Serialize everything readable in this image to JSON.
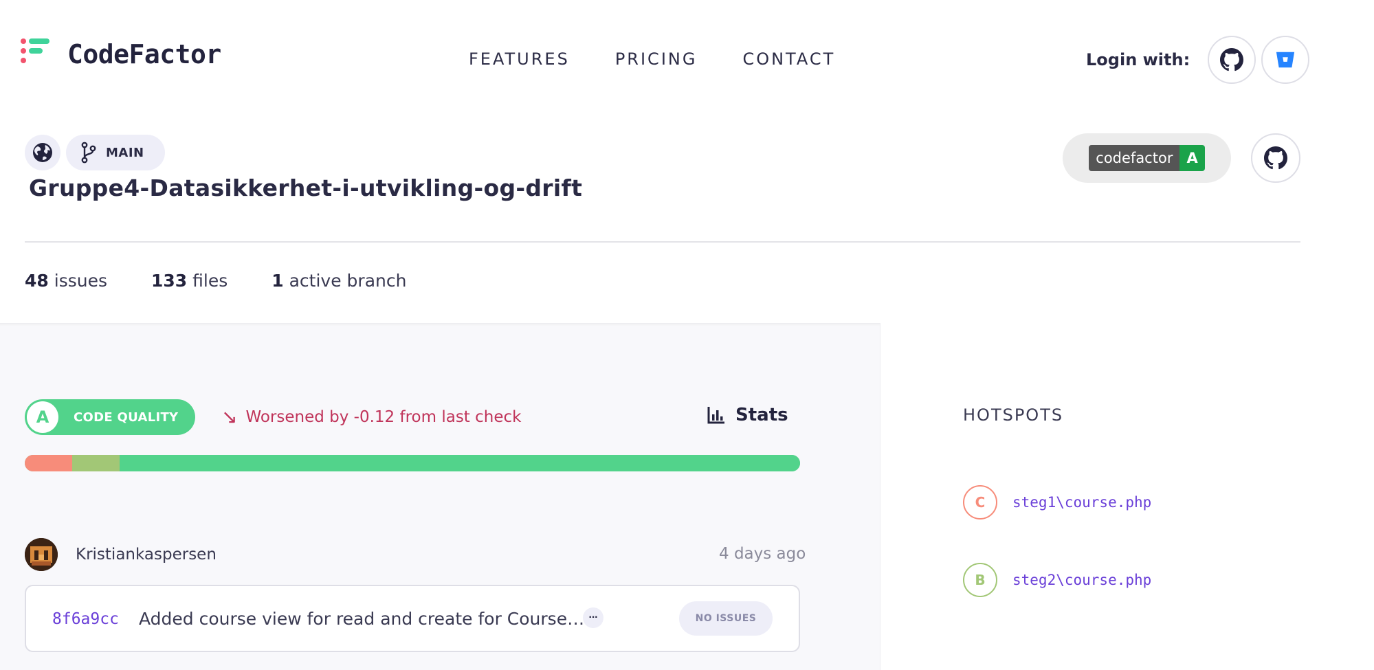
{
  "brand": {
    "name": "CodeFactor"
  },
  "nav": {
    "features": "FEATURES",
    "pricing": "PRICING",
    "contact": "CONTACT"
  },
  "login": {
    "label": "Login with:",
    "providers": [
      "github-icon",
      "bitbucket-icon"
    ]
  },
  "repo": {
    "visibility_icon": "globe-icon",
    "branch": "MAIN",
    "name": "Gruppe4-Datasikkerhet-i-utvikling-og-drift",
    "badge_left": "codefactor",
    "badge_right": "A"
  },
  "summary": {
    "issues_count": "48",
    "issues_label": "issues",
    "files_count": "133",
    "files_label": "files",
    "branches_count": "1",
    "branches_label": "active branch"
  },
  "quality": {
    "grade": "A",
    "label": "CODE QUALITY",
    "trend_arrow": "↘",
    "trend_text": "Worsened by -0.12 from last check",
    "stats_label": "Stats",
    "distribution": [
      {
        "grade": "C",
        "fraction": 0.061,
        "color": "#f78c7a"
      },
      {
        "grade": "B",
        "fraction": 0.061,
        "color": "#a2c776"
      },
      {
        "grade": "A",
        "fraction": 0.878,
        "color": "#52d38b"
      }
    ]
  },
  "commit": {
    "author": "Kristiankaspersen",
    "time": "4 days ago",
    "hash": "8f6a9cc",
    "message": "Added course view for read and create for Course model",
    "more": "···",
    "status": "NO ISSUES"
  },
  "hotspots": {
    "title": "HOTSPOTS",
    "items": [
      {
        "grade": "C",
        "file": "steg1\\course.php",
        "color": "#f78c7a"
      },
      {
        "grade": "B",
        "file": "steg2\\course.php",
        "color": "#a2c776"
      }
    ]
  }
}
